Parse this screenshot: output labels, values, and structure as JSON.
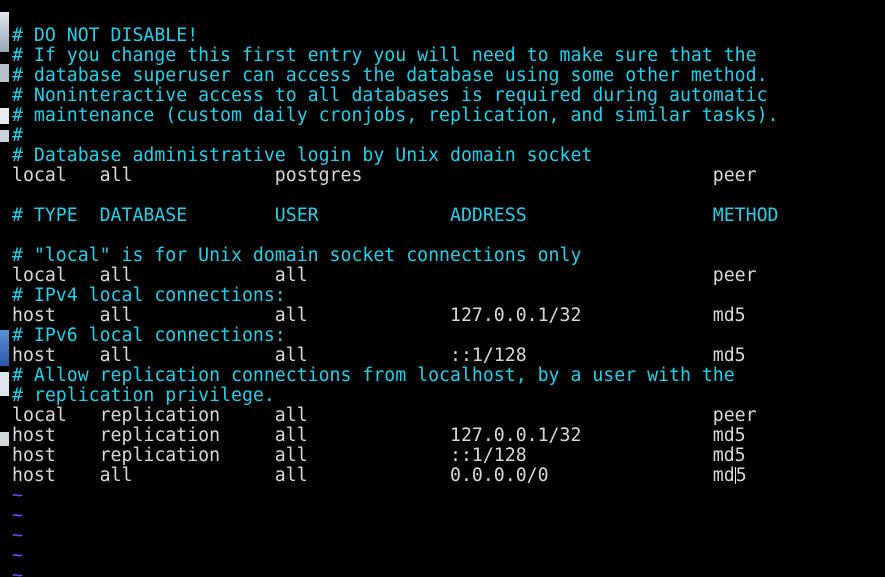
{
  "colors": {
    "background": "#000000",
    "comment": "#21d1e9",
    "config": "#d8d8d8",
    "tilde": "#4f63ff"
  },
  "editor": {
    "lines": [
      {
        "kind": "comment",
        "text": "# DO NOT DISABLE!"
      },
      {
        "kind": "comment",
        "text": "# If you change this first entry you will need to make sure that the"
      },
      {
        "kind": "comment",
        "text": "# database superuser can access the database using some other method."
      },
      {
        "kind": "comment",
        "text": "# Noninteractive access to all databases is required during automatic"
      },
      {
        "kind": "comment",
        "text": "# maintenance (custom daily cronjobs, replication, and similar tasks)."
      },
      {
        "kind": "comment",
        "text": "#"
      },
      {
        "kind": "comment",
        "text": "# Database administrative login by Unix domain socket"
      },
      {
        "kind": "config",
        "text": "local   all             postgres                                peer"
      },
      {
        "kind": "blank",
        "text": ""
      },
      {
        "kind": "comment",
        "text": "# TYPE  DATABASE        USER            ADDRESS                 METHOD"
      },
      {
        "kind": "blank",
        "text": ""
      },
      {
        "kind": "comment",
        "text": "# \"local\" is for Unix domain socket connections only"
      },
      {
        "kind": "config",
        "text": "local   all             all                                     peer"
      },
      {
        "kind": "comment",
        "text": "# IPv4 local connections:"
      },
      {
        "kind": "config",
        "text": "host    all             all             127.0.0.1/32            md5"
      },
      {
        "kind": "comment",
        "text": "# IPv6 local connections:"
      },
      {
        "kind": "config",
        "text": "host    all             all             ::1/128                 md5"
      },
      {
        "kind": "comment",
        "text": "# Allow replication connections from localhost, by a user with the"
      },
      {
        "kind": "comment",
        "text": "# replication privilege."
      },
      {
        "kind": "config",
        "text": "local   replication     all                                     peer"
      },
      {
        "kind": "config",
        "text": "host    replication     all             127.0.0.1/32            md5"
      },
      {
        "kind": "config",
        "text": "host    replication     all             ::1/128                 md5"
      },
      {
        "kind": "config",
        "text": "host    all             all             0.0.0.0/0               md5",
        "cursor_after_chars": 66
      },
      {
        "kind": "tilde",
        "text": "~"
      },
      {
        "kind": "tilde",
        "text": "~"
      },
      {
        "kind": "tilde",
        "text": "~"
      },
      {
        "kind": "tilde",
        "text": "~"
      },
      {
        "kind": "tilde",
        "text": "~"
      }
    ]
  }
}
